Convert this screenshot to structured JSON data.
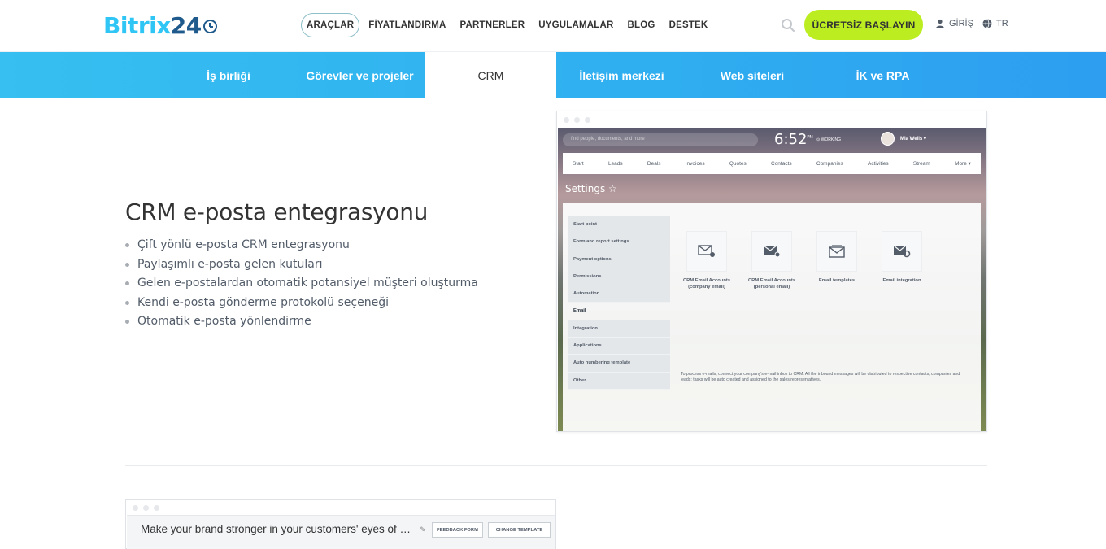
{
  "header": {
    "logo_brand": "Bitrix",
    "logo_number": "24",
    "nav": [
      "ARAÇLAR",
      "FİYATLANDIRMA",
      "PARTNERLER",
      "UYGULAMALAR",
      "BLOG",
      "DESTEK"
    ],
    "cta_label": "ÜCRETSİZ BAŞLAYIN",
    "login_label": "GİRİŞ",
    "lang_label": "TR",
    "accent": "#bbed21"
  },
  "subnav": {
    "items": [
      "İş birliği",
      "Görevler ve projeler",
      "CRM",
      "İletişim merkezi",
      "Web siteleri",
      "İK ve RPA"
    ],
    "active": "CRM"
  },
  "feature": {
    "title": "CRM e-posta entegrasyonu",
    "bullets": [
      "Çift yönlü e-posta CRM entegrasyonu",
      "Paylaşımlı e-posta gelen kutuları",
      "Gelen e-postalardan otomatik potansiyel müşteri oluşturma",
      "Kendi e-posta gönderme protokolü seçeneği",
      "Otomatik e-posta yönlendirme"
    ]
  },
  "mock": {
    "search_placeholder": "find people, documents, and more",
    "time": "6:52",
    "time_suffix": "PM",
    "working_label": "WORKING",
    "user_name": "Mia Wells",
    "menu": [
      "Start",
      "Leads",
      "Deals",
      "Invoices",
      "Quotes",
      "Contacts",
      "Companies",
      "Activities",
      "Stream",
      "More"
    ],
    "page_title": "Settings ☆",
    "sidebar": [
      "Start point",
      "Form and report settings",
      "Payment options",
      "Permissions",
      "Automation",
      "Email",
      "Integration",
      "Applications",
      "Auto numbering template",
      "Other"
    ],
    "sidebar_active": "Email",
    "tiles": [
      "CRM Email Accounts (company email)",
      "CRM Email Accounts (personal email)",
      "Email templates",
      "Email integration"
    ],
    "note": "To process e-mails, connect your company's e-mail inbox to CRM. All the inbound messages will be distributed to respective contacts, companies and leads; tasks will be auto created and assigned to the sales representatives."
  },
  "mock2": {
    "text": "Make your brand stronger in your customers' eyes of September",
    "btn_feedback": "FEEDBACK FORM",
    "btn_template": "CHANGE TEMPLATE"
  }
}
